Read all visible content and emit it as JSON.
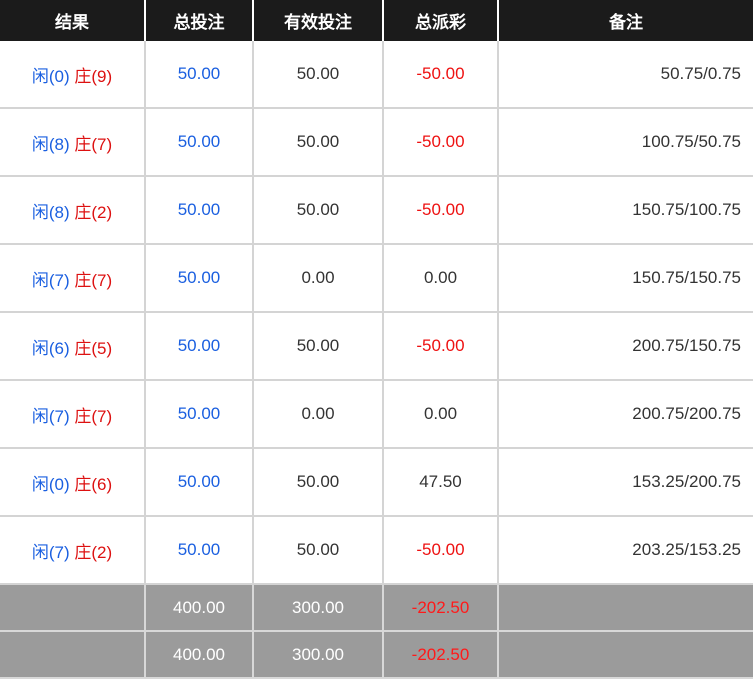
{
  "headers": {
    "result": "结果",
    "total_bet": "总投注",
    "valid_bet": "有效投注",
    "total_payout": "总派彩",
    "remarks": "备注"
  },
  "rows": [
    {
      "player": "闲(0)",
      "banker": "庄(9)",
      "total_bet": "50.00",
      "valid_bet": "50.00",
      "payout": "-50.00",
      "remark": "50.75/0.75"
    },
    {
      "player": "闲(8)",
      "banker": "庄(7)",
      "total_bet": "50.00",
      "valid_bet": "50.00",
      "payout": "-50.00",
      "remark": "100.75/50.75"
    },
    {
      "player": "闲(8)",
      "banker": "庄(2)",
      "total_bet": "50.00",
      "valid_bet": "50.00",
      "payout": "-50.00",
      "remark": "150.75/100.75"
    },
    {
      "player": "闲(7)",
      "banker": "庄(7)",
      "total_bet": "50.00",
      "valid_bet": "0.00",
      "payout": "0.00",
      "remark": "150.75/150.75"
    },
    {
      "player": "闲(6)",
      "banker": "庄(5)",
      "total_bet": "50.00",
      "valid_bet": "50.00",
      "payout": "-50.00",
      "remark": "200.75/150.75"
    },
    {
      "player": "闲(7)",
      "banker": "庄(7)",
      "total_bet": "50.00",
      "valid_bet": "0.00",
      "payout": "0.00",
      "remark": "200.75/200.75"
    },
    {
      "player": "闲(0)",
      "banker": "庄(6)",
      "total_bet": "50.00",
      "valid_bet": "50.00",
      "payout": "47.50",
      "remark": "153.25/200.75"
    },
    {
      "player": "闲(7)",
      "banker": "庄(2)",
      "total_bet": "50.00",
      "valid_bet": "50.00",
      "payout": "-50.00",
      "remark": "203.25/153.25"
    }
  ],
  "subtotal": {
    "total_bet": "400.00",
    "valid_bet": "300.00",
    "payout": "-202.50"
  },
  "total": {
    "total_bet": "400.00",
    "valid_bet": "300.00",
    "payout": "-202.50"
  },
  "colors": {
    "header_bg": "#1b1b1b",
    "footer_bg": "#9b9b9b",
    "player": "#1a5fe0",
    "banker": "#dd1111",
    "negative": "#ee1111",
    "bet": "#1a5fe0"
  }
}
